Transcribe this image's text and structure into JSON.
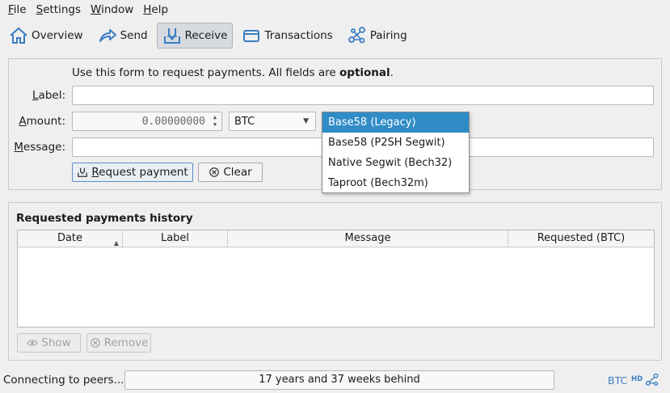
{
  "menu": {
    "file": {
      "u": "F",
      "rest": "ile"
    },
    "settings": {
      "u": "S",
      "rest": "ettings"
    },
    "window": {
      "u": "W",
      "rest": "indow"
    },
    "help": {
      "u": "H",
      "rest": "elp"
    }
  },
  "toolbar": {
    "overview": "Overview",
    "send": "Send",
    "receive": "Receive",
    "transactions": "Transactions",
    "pairing": "Pairing"
  },
  "form": {
    "intro_prefix": "Use this form to request payments. All fields are ",
    "intro_bold": "optional",
    "intro_suffix": ".",
    "label_u": "L",
    "label_rest": "abel:",
    "amount_u": "A",
    "amount_rest": "mount:",
    "message_u": "M",
    "message_rest": "essage:",
    "amount_value": "0.00000000",
    "unit": "BTC",
    "request_u": "R",
    "request_rest": "equest payment",
    "clear": "Clear"
  },
  "address_type_dropdown": {
    "options": [
      "Base58 (Legacy)",
      "Base58 (P2SH Segwit)",
      "Native Segwit (Bech32)",
      "Taproot (Bech32m)"
    ],
    "selected_index": 0
  },
  "history": {
    "title": "Requested payments history",
    "columns": [
      "Date",
      "Label",
      "Message",
      "Requested (BTC)"
    ],
    "rows": [],
    "show": "Show",
    "remove": "Remove"
  },
  "status": {
    "text": "Connecting to peers...",
    "progress_text": "17 years and 37 weeks behind",
    "unit": "BTC",
    "hd": "HD"
  },
  "colors": {
    "selection": "#308cc6",
    "accent": "#3a7cc3"
  }
}
